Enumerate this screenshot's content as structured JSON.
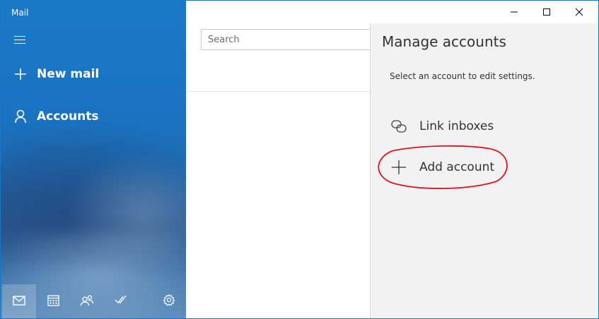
{
  "app": {
    "title": "Mail"
  },
  "sidebar": {
    "new_mail_label": "New mail",
    "accounts_label": "Accounts",
    "bottom_icons": [
      "mail-icon",
      "calendar-icon",
      "people-icon",
      "todo-icon",
      "settings-icon"
    ]
  },
  "search": {
    "placeholder": "Search"
  },
  "panel": {
    "title": "Manage accounts",
    "subtitle": "Select an account to edit settings.",
    "link_inboxes_label": "Link inboxes",
    "add_account_label": "Add account"
  },
  "colors": {
    "accent": "#1a73c2",
    "annotation": "#e0141e",
    "panel_bg": "#f2f2f2"
  }
}
